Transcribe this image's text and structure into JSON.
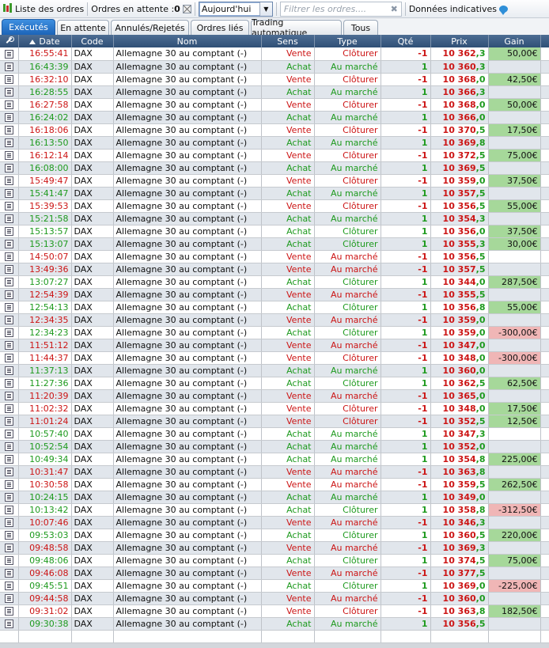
{
  "toolbar": {
    "orders_list_label": "Liste des ordres",
    "pending_label": "Ordres en attente :",
    "pending_count": "0",
    "period_value": "Aujourd'hui",
    "filter_placeholder": "Filtrer les ordres....",
    "data_info_label": "Données indicatives"
  },
  "tabs": [
    "Exécutés",
    "En attente",
    "Annulés/Rejetés",
    "Ordres liés",
    "Trading automatique",
    "Tous"
  ],
  "columns": {
    "date": "Date",
    "code": "Code",
    "nom": "Nom",
    "sens": "Sens",
    "type": "Type",
    "qte": "Qté",
    "prix": "Prix",
    "gain": "Gain"
  },
  "colors": {
    "buy": "#1e9a1e",
    "sell": "#cc1515",
    "gain_positive": "#a6d89a",
    "gain_negative": "#f0b6b6",
    "header": "#3b5a80",
    "tab_active": "#2a78cf"
  },
  "rows": [
    {
      "time": "16:55:41",
      "code": "DAX",
      "nom": "Allemagne 30 au comptant (-)",
      "sens": "Vente",
      "type": "Clôturer",
      "qte": "-1",
      "prix_a": "10 362",
      "prix_b": ",3",
      "gain": "50,00€"
    },
    {
      "time": "16:43:39",
      "code": "DAX",
      "nom": "Allemagne 30 au comptant (-)",
      "sens": "Achat",
      "type": "Au marché",
      "qte": "1",
      "prix_a": "10 360",
      "prix_b": ",3",
      "gain": ""
    },
    {
      "time": "16:32:10",
      "code": "DAX",
      "nom": "Allemagne 30 au comptant (-)",
      "sens": "Vente",
      "type": "Clôturer",
      "qte": "-1",
      "prix_a": "10 368",
      "prix_b": ",0",
      "gain": "42,50€"
    },
    {
      "time": "16:28:55",
      "code": "DAX",
      "nom": "Allemagne 30 au comptant (-)",
      "sens": "Achat",
      "type": "Au marché",
      "qte": "1",
      "prix_a": "10 366",
      "prix_b": ",3",
      "gain": ""
    },
    {
      "time": "16:27:58",
      "code": "DAX",
      "nom": "Allemagne 30 au comptant (-)",
      "sens": "Vente",
      "type": "Clôturer",
      "qte": "-1",
      "prix_a": "10 368",
      "prix_b": ",0",
      "gain": "50,00€"
    },
    {
      "time": "16:24:02",
      "code": "DAX",
      "nom": "Allemagne 30 au comptant (-)",
      "sens": "Achat",
      "type": "Au marché",
      "qte": "1",
      "prix_a": "10 366",
      "prix_b": ",0",
      "gain": ""
    },
    {
      "time": "16:18:06",
      "code": "DAX",
      "nom": "Allemagne 30 au comptant (-)",
      "sens": "Vente",
      "type": "Clôturer",
      "qte": "-1",
      "prix_a": "10 370",
      "prix_b": ",5",
      "gain": "17,50€"
    },
    {
      "time": "16:13:50",
      "code": "DAX",
      "nom": "Allemagne 30 au comptant (-)",
      "sens": "Achat",
      "type": "Au marché",
      "qte": "1",
      "prix_a": "10 369",
      "prix_b": ",8",
      "gain": ""
    },
    {
      "time": "16:12:14",
      "code": "DAX",
      "nom": "Allemagne 30 au comptant (-)",
      "sens": "Vente",
      "type": "Clôturer",
      "qte": "-1",
      "prix_a": "10 372",
      "prix_b": ",5",
      "gain": "75,00€"
    },
    {
      "time": "16:08:00",
      "code": "DAX",
      "nom": "Allemagne 30 au comptant (-)",
      "sens": "Achat",
      "type": "Au marché",
      "qte": "1",
      "prix_a": "10 369",
      "prix_b": ",5",
      "gain": ""
    },
    {
      "time": "15:49:47",
      "code": "DAX",
      "nom": "Allemagne 30 au comptant (-)",
      "sens": "Vente",
      "type": "Clôturer",
      "qte": "-1",
      "prix_a": "10 359",
      "prix_b": ",0",
      "gain": "37,50€"
    },
    {
      "time": "15:41:47",
      "code": "DAX",
      "nom": "Allemagne 30 au comptant (-)",
      "sens": "Achat",
      "type": "Au marché",
      "qte": "1",
      "prix_a": "10 357",
      "prix_b": ",5",
      "gain": ""
    },
    {
      "time": "15:39:53",
      "code": "DAX",
      "nom": "Allemagne 30 au comptant (-)",
      "sens": "Vente",
      "type": "Clôturer",
      "qte": "-1",
      "prix_a": "10 356",
      "prix_b": ",5",
      "gain": "55,00€"
    },
    {
      "time": "15:21:58",
      "code": "DAX",
      "nom": "Allemagne 30 au comptant (-)",
      "sens": "Achat",
      "type": "Au marché",
      "qte": "1",
      "prix_a": "10 354",
      "prix_b": ",3",
      "gain": ""
    },
    {
      "time": "15:13:57",
      "code": "DAX",
      "nom": "Allemagne 30 au comptant (-)",
      "sens": "Achat",
      "type": "Clôturer",
      "qte": "1",
      "prix_a": "10 356",
      "prix_b": ",0",
      "gain": "37,50€"
    },
    {
      "time": "15:13:07",
      "code": "DAX",
      "nom": "Allemagne 30 au comptant (-)",
      "sens": "Achat",
      "type": "Clôturer",
      "qte": "1",
      "prix_a": "10 355",
      "prix_b": ",3",
      "gain": "30,00€"
    },
    {
      "time": "14:50:07",
      "code": "DAX",
      "nom": "Allemagne 30 au comptant (-)",
      "sens": "Vente",
      "type": "Au marché",
      "qte": "-1",
      "prix_a": "10 356",
      "prix_b": ",5",
      "gain": ""
    },
    {
      "time": "13:49:36",
      "code": "DAX",
      "nom": "Allemagne 30 au comptant (-)",
      "sens": "Vente",
      "type": "Au marché",
      "qte": "-1",
      "prix_a": "10 357",
      "prix_b": ",5",
      "gain": ""
    },
    {
      "time": "13:07:27",
      "code": "DAX",
      "nom": "Allemagne 30 au comptant (-)",
      "sens": "Achat",
      "type": "Clôturer",
      "qte": "1",
      "prix_a": "10 344",
      "prix_b": ",0",
      "gain": "287,50€"
    },
    {
      "time": "12:54:39",
      "code": "DAX",
      "nom": "Allemagne 30 au comptant (-)",
      "sens": "Vente",
      "type": "Au marché",
      "qte": "-1",
      "prix_a": "10 355",
      "prix_b": ",5",
      "gain": ""
    },
    {
      "time": "12:54:13",
      "code": "DAX",
      "nom": "Allemagne 30 au comptant (-)",
      "sens": "Achat",
      "type": "Clôturer",
      "qte": "1",
      "prix_a": "10 356",
      "prix_b": ",8",
      "gain": "55,00€"
    },
    {
      "time": "12:34:35",
      "code": "DAX",
      "nom": "Allemagne 30 au comptant (-)",
      "sens": "Vente",
      "type": "Au marché",
      "qte": "-1",
      "prix_a": "10 359",
      "prix_b": ",0",
      "gain": ""
    },
    {
      "time": "12:34:23",
      "code": "DAX",
      "nom": "Allemagne 30 au comptant (-)",
      "sens": "Achat",
      "type": "Clôturer",
      "qte": "1",
      "prix_a": "10 359",
      "prix_b": ",0",
      "gain": "-300,00€"
    },
    {
      "time": "11:51:12",
      "code": "DAX",
      "nom": "Allemagne 30 au comptant (-)",
      "sens": "Vente",
      "type": "Au marché",
      "qte": "-1",
      "prix_a": "10 347",
      "prix_b": ",0",
      "gain": ""
    },
    {
      "time": "11:44:37",
      "code": "DAX",
      "nom": "Allemagne 30 au comptant (-)",
      "sens": "Vente",
      "type": "Clôturer",
      "qte": "-1",
      "prix_a": "10 348",
      "prix_b": ",0",
      "gain": "-300,00€"
    },
    {
      "time": "11:37:13",
      "code": "DAX",
      "nom": "Allemagne 30 au comptant (-)",
      "sens": "Achat",
      "type": "Au marché",
      "qte": "1",
      "prix_a": "10 360",
      "prix_b": ",0",
      "gain": ""
    },
    {
      "time": "11:27:36",
      "code": "DAX",
      "nom": "Allemagne 30 au comptant (-)",
      "sens": "Achat",
      "type": "Clôturer",
      "qte": "1",
      "prix_a": "10 362",
      "prix_b": ",5",
      "gain": "62,50€"
    },
    {
      "time": "11:20:39",
      "code": "DAX",
      "nom": "Allemagne 30 au comptant (-)",
      "sens": "Vente",
      "type": "Au marché",
      "qte": "-1",
      "prix_a": "10 365",
      "prix_b": ",0",
      "gain": ""
    },
    {
      "time": "11:02:32",
      "code": "DAX",
      "nom": "Allemagne 30 au comptant (-)",
      "sens": "Vente",
      "type": "Clôturer",
      "qte": "-1",
      "prix_a": "10 348",
      "prix_b": ",0",
      "gain": "17,50€"
    },
    {
      "time": "11:01:24",
      "code": "DAX",
      "nom": "Allemagne 30 au comptant (-)",
      "sens": "Vente",
      "type": "Clôturer",
      "qte": "-1",
      "prix_a": "10 352",
      "prix_b": ",5",
      "gain": "12,50€"
    },
    {
      "time": "10:57:40",
      "code": "DAX",
      "nom": "Allemagne 30 au comptant (-)",
      "sens": "Achat",
      "type": "Au marché",
      "qte": "1",
      "prix_a": "10 347",
      "prix_b": ",3",
      "gain": ""
    },
    {
      "time": "10:52:54",
      "code": "DAX",
      "nom": "Allemagne 30 au comptant (-)",
      "sens": "Achat",
      "type": "Au marché",
      "qte": "1",
      "prix_a": "10 352",
      "prix_b": ",0",
      "gain": ""
    },
    {
      "time": "10:49:34",
      "code": "DAX",
      "nom": "Allemagne 30 au comptant (-)",
      "sens": "Achat",
      "type": "Au marché",
      "qte": "1",
      "prix_a": "10 354",
      "prix_b": ",8",
      "gain": "225,00€"
    },
    {
      "time": "10:31:47",
      "code": "DAX",
      "nom": "Allemagne 30 au comptant (-)",
      "sens": "Vente",
      "type": "Au marché",
      "qte": "-1",
      "prix_a": "10 363",
      "prix_b": ",8",
      "gain": ""
    },
    {
      "time": "10:30:58",
      "code": "DAX",
      "nom": "Allemagne 30 au comptant (-)",
      "sens": "Vente",
      "type": "Au marché",
      "qte": "-1",
      "prix_a": "10 359",
      "prix_b": ",5",
      "gain": "262,50€"
    },
    {
      "time": "10:24:15",
      "code": "DAX",
      "nom": "Allemagne 30 au comptant (-)",
      "sens": "Achat",
      "type": "Au marché",
      "qte": "1",
      "prix_a": "10 349",
      "prix_b": ",0",
      "gain": ""
    },
    {
      "time": "10:13:42",
      "code": "DAX",
      "nom": "Allemagne 30 au comptant (-)",
      "sens": "Achat",
      "type": "Clôturer",
      "qte": "1",
      "prix_a": "10 358",
      "prix_b": ",8",
      "gain": "-312,50€"
    },
    {
      "time": "10:07:46",
      "code": "DAX",
      "nom": "Allemagne 30 au comptant (-)",
      "sens": "Vente",
      "type": "Au marché",
      "qte": "-1",
      "prix_a": "10 346",
      "prix_b": ",3",
      "gain": ""
    },
    {
      "time": "09:53:03",
      "code": "DAX",
      "nom": "Allemagne 30 au comptant (-)",
      "sens": "Achat",
      "type": "Clôturer",
      "qte": "1",
      "prix_a": "10 360",
      "prix_b": ",5",
      "gain": "220,00€"
    },
    {
      "time": "09:48:58",
      "code": "DAX",
      "nom": "Allemagne 30 au comptant (-)",
      "sens": "Vente",
      "type": "Au marché",
      "qte": "-1",
      "prix_a": "10 369",
      "prix_b": ",3",
      "gain": ""
    },
    {
      "time": "09:48:06",
      "code": "DAX",
      "nom": "Allemagne 30 au comptant (-)",
      "sens": "Achat",
      "type": "Clôturer",
      "qte": "1",
      "prix_a": "10 374",
      "prix_b": ",5",
      "gain": "75,00€"
    },
    {
      "time": "09:46:08",
      "code": "DAX",
      "nom": "Allemagne 30 au comptant (-)",
      "sens": "Vente",
      "type": "Au marché",
      "qte": "-1",
      "prix_a": "10 377",
      "prix_b": ",5",
      "gain": ""
    },
    {
      "time": "09:45:51",
      "code": "DAX",
      "nom": "Allemagne 30 au comptant (-)",
      "sens": "Achat",
      "type": "Clôturer",
      "qte": "1",
      "prix_a": "10 369",
      "prix_b": ",0",
      "gain": "-225,00€"
    },
    {
      "time": "09:44:58",
      "code": "DAX",
      "nom": "Allemagne 30 au comptant (-)",
      "sens": "Vente",
      "type": "Au marché",
      "qte": "-1",
      "prix_a": "10 360",
      "prix_b": ",0",
      "gain": ""
    },
    {
      "time": "09:31:02",
      "code": "DAX",
      "nom": "Allemagne 30 au comptant (-)",
      "sens": "Vente",
      "type": "Clôturer",
      "qte": "-1",
      "prix_a": "10 363",
      "prix_b": ",8",
      "gain": "182,50€"
    },
    {
      "time": "09:30:38",
      "code": "DAX",
      "nom": "Allemagne 30 au comptant (-)",
      "sens": "Achat",
      "type": "Au marché",
      "qte": "1",
      "prix_a": "10 356",
      "prix_b": ",5",
      "gain": ""
    }
  ]
}
